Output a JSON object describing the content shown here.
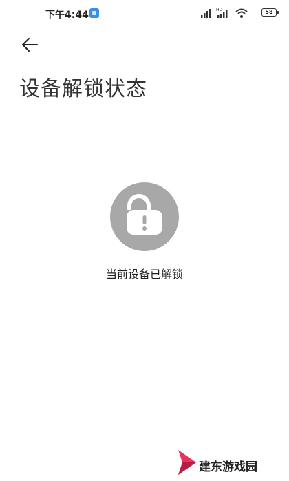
{
  "status_bar": {
    "time": "下午4:44",
    "battery": "58",
    "icons": [
      "signal-icon",
      "hd-signal-icon",
      "wifi-icon",
      "battery-icon"
    ]
  },
  "header": {
    "back_icon": "arrow-left-icon",
    "title": "设备解锁状态"
  },
  "main": {
    "status_icon": "unlocked-padlock-icon",
    "status_text": "当前设备已解锁"
  },
  "watermark": {
    "text": "建东游戏园"
  },
  "colors": {
    "background": "#ffffff",
    "lock_circle": "#a8a8a8",
    "text": "#222222",
    "watermark_red": "#e8335a"
  }
}
